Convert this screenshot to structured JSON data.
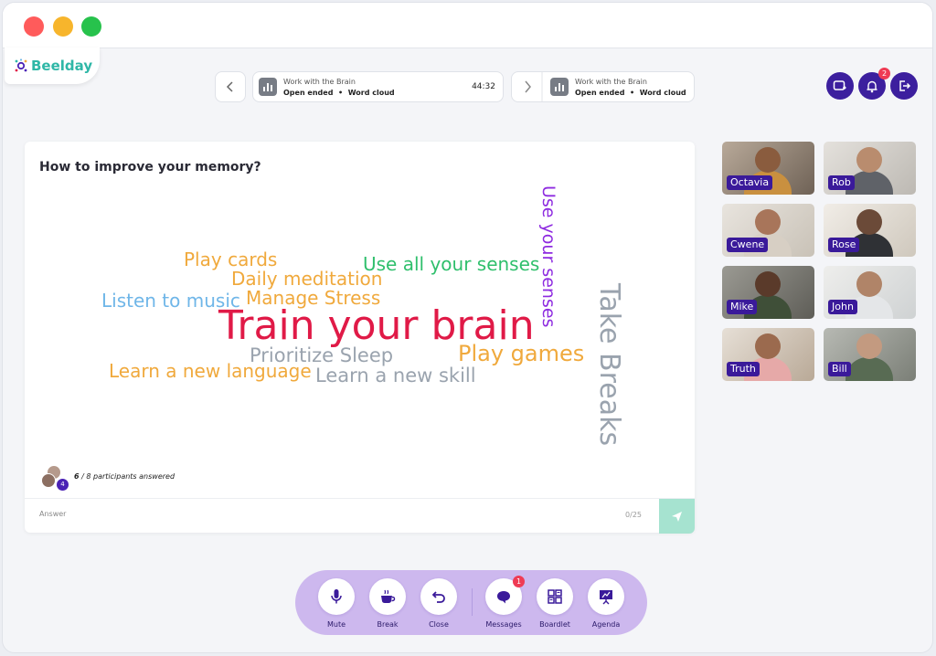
{
  "app": {
    "name": "Beelday"
  },
  "activity_nav": {
    "current": {
      "title": "Work with the Brain",
      "type": "Open ended",
      "format": "Word cloud",
      "timer": "44:32"
    },
    "next": {
      "title": "Work with the Brain",
      "type": "Open ended",
      "format": "Word cloud"
    },
    "separator": "•"
  },
  "header": {
    "notification_count": "2"
  },
  "main": {
    "question": "How to improve your memory?",
    "words": [
      {
        "text": "Train your brain",
        "color": "#e01a47"
      },
      {
        "text": "Take Breaks",
        "color": "#9aa3ae"
      },
      {
        "text": "Use your senses",
        "color": "#8e2be0"
      },
      {
        "text": "Use all your senses",
        "color": "#2fbf6c"
      },
      {
        "text": "Play cards",
        "color": "#f0a93c"
      },
      {
        "text": "Daily meditation",
        "color": "#f0a93c"
      },
      {
        "text": "Manage Stress",
        "color": "#f0a93c"
      },
      {
        "text": "Listen to music",
        "color": "#6fb6e8"
      },
      {
        "text": "Prioritize Sleep",
        "color": "#9aa3ae"
      },
      {
        "text": "Play games",
        "color": "#f0a93c"
      },
      {
        "text": "Learn a new language",
        "color": "#f0a93c"
      },
      {
        "text": "Learn a new skill",
        "color": "#9aa3ae"
      }
    ],
    "participants": {
      "answered": "6",
      "rest": " / 8 participants answered",
      "badge": "4"
    },
    "answer": {
      "placeholder": "Answer",
      "counter": "0/25"
    }
  },
  "participants_video": [
    {
      "name": "Octavia"
    },
    {
      "name": "Rob"
    },
    {
      "name": "Cwene"
    },
    {
      "name": "Rose"
    },
    {
      "name": "Mike"
    },
    {
      "name": "John"
    },
    {
      "name": "Truth"
    },
    {
      "name": "Bill"
    }
  ],
  "dock": {
    "items": [
      {
        "label": "Mute",
        "icon": "microphone-icon"
      },
      {
        "label": "Break",
        "icon": "coffee-cup-icon"
      },
      {
        "label": "Close",
        "icon": "undo-arrow-icon"
      },
      {
        "label": "Messages",
        "icon": "chat-bubble-icon",
        "badge": "1"
      },
      {
        "label": "Boardlet",
        "icon": "board-grid-icon"
      },
      {
        "label": "Agenda",
        "icon": "presentation-easel-icon"
      }
    ]
  },
  "colors": {
    "accent": "#3c1f9e",
    "dock_bg": "#cdb8ee",
    "send_bg": "#a6e3d0",
    "badge": "#ef3b54",
    "logo": "#2fb7a7"
  }
}
